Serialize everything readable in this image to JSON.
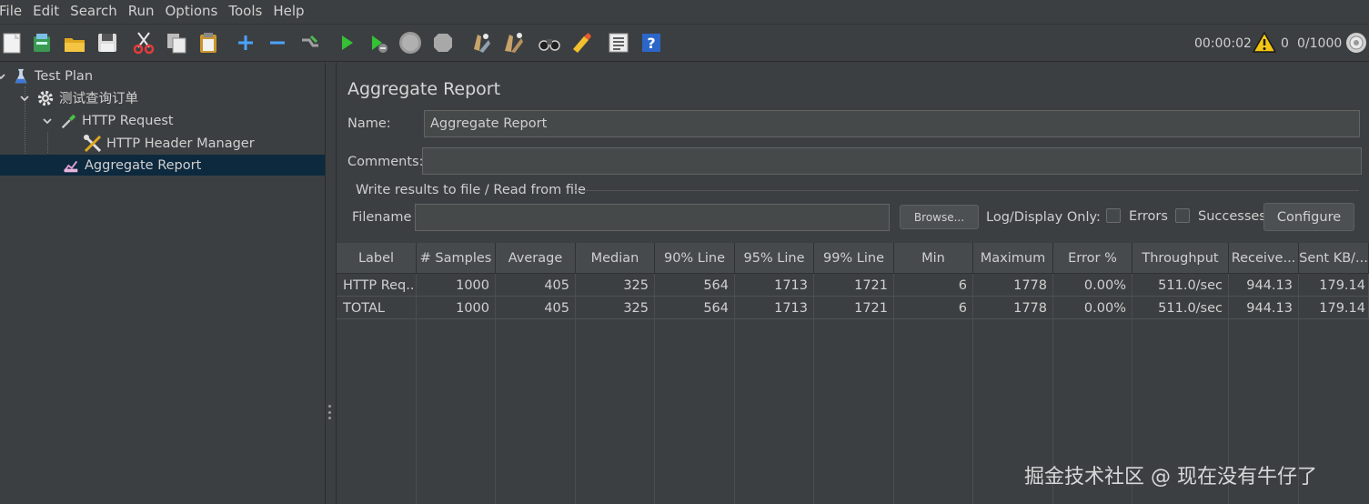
{
  "menu": [
    {
      "id": "file",
      "label": "File"
    },
    {
      "id": "edit",
      "label": "Edit"
    },
    {
      "id": "search",
      "label": "Search"
    },
    {
      "id": "run",
      "label": "Run"
    },
    {
      "id": "options",
      "label": "Options"
    },
    {
      "id": "tools",
      "label": "Tools"
    },
    {
      "id": "help",
      "label": "Help"
    }
  ],
  "toolbar": {
    "icons": [
      "new-icon",
      "templates-icon",
      "open-icon",
      "save-icon",
      "cut-icon",
      "copy-icon",
      "paste-icon",
      "expand-icon",
      "collapse-icon",
      "toggle-icon",
      "start-icon",
      "start-no-pauses-icon",
      "stop-icon",
      "shutdown-icon",
      "clear-icon",
      "clear-all-icon",
      "search-icon",
      "reset-search-icon",
      "function-helper-icon",
      "help-icon"
    ],
    "timer": "00:00:02",
    "warning_count": "0",
    "threads": "0/1000"
  },
  "tree": {
    "items": [
      {
        "label": "Test Plan",
        "icon": "flask-icon"
      },
      {
        "label": "测试查询订单",
        "icon": "gear-icon"
      },
      {
        "label": "HTTP Request",
        "icon": "pipette-icon"
      },
      {
        "label": "HTTP Header Manager",
        "icon": "wrench-screwdriver-icon"
      },
      {
        "label": "Aggregate Report",
        "icon": "report-icon"
      }
    ]
  },
  "panel": {
    "title": "Aggregate Report",
    "name_label": "Name:",
    "name_value": "Aggregate Report",
    "comments_label": "Comments:",
    "comments_value": "",
    "file_group_title": "Write results to file / Read from file",
    "filename_label": "Filename",
    "filename_value": "",
    "browse_label": "Browse...",
    "log_display_label": "Log/Display Only:",
    "errors_label": "Errors",
    "successes_label": "Successes",
    "configure_label": "Configure"
  },
  "table": {
    "headers": [
      "Label",
      "# Samples",
      "Average",
      "Median",
      "90% Line",
      "95% Line",
      "99% Line",
      "Min",
      "Maximum",
      "Error %",
      "Throughput",
      "Receive...",
      "Sent KB/..."
    ],
    "rows": [
      [
        "HTTP Req...",
        "1000",
        "405",
        "325",
        "564",
        "1713",
        "1721",
        "6",
        "1778",
        "0.00%",
        "511.0/sec",
        "944.13",
        "179.14"
      ],
      [
        "TOTAL",
        "1000",
        "405",
        "325",
        "564",
        "1713",
        "1721",
        "6",
        "1778",
        "0.00%",
        "511.0/sec",
        "944.13",
        "179.14"
      ]
    ]
  },
  "watermark": "掘金技术社区 @ 现在没有牛仔了"
}
